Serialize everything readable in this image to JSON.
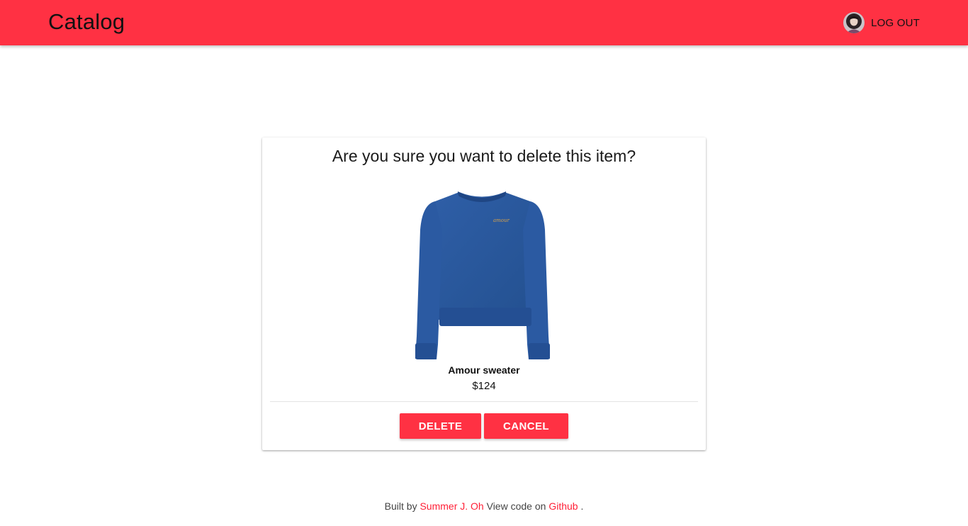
{
  "header": {
    "title": "Catalog",
    "logout_label": "LOG OUT",
    "avatar_icon": "user-avatar",
    "accent_color": "#ff3143"
  },
  "dialog": {
    "question": "Are you sure you want to delete this item?",
    "product": {
      "name": "Amour sweater",
      "price": "$124",
      "image_icon": "blue-sweater-image",
      "embroidery": "amour"
    },
    "delete_label": "DELETE",
    "cancel_label": "CANCEL"
  },
  "footer": {
    "built_by": "Built by",
    "author": "Summer J. Oh",
    "view_code": "View code on",
    "repo_link": "Github",
    "end": "."
  }
}
